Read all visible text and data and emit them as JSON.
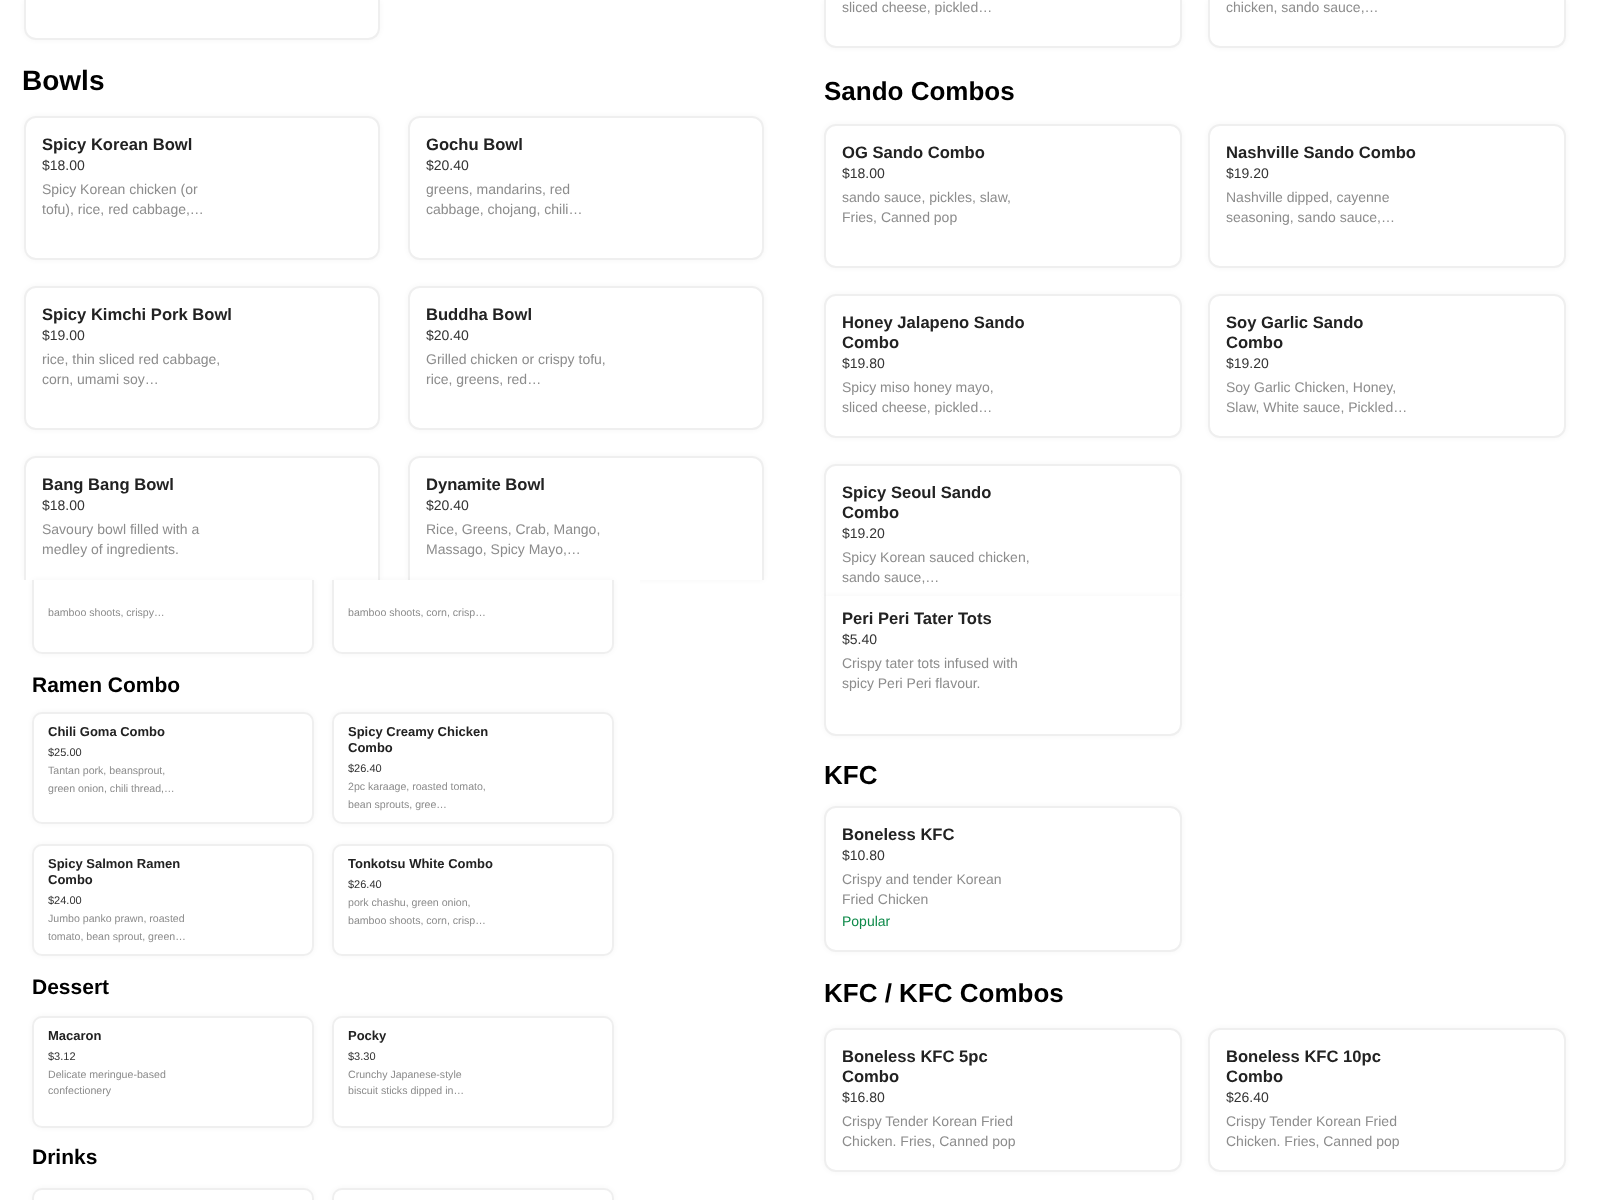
{
  "left_column": {
    "upper_view": {
      "sections": [
        {
          "heading": "Bowls",
          "items": [
            {
              "name": "Spicy Korean Bowl",
              "price": "$18.00",
              "description": "Spicy Korean chicken (or tofu), rice, red cabbage,…"
            },
            {
              "name": "Gochu Bowl",
              "price": "$20.40",
              "description": "greens, mandarins, red cabbage, chojang, chili…"
            },
            {
              "name": "Spicy Kimchi Pork Bowl",
              "price": "$19.00",
              "description": "rice, thin sliced red cabbage, corn, umami soy…"
            },
            {
              "name": "Buddha Bowl",
              "price": "$20.40",
              "description": "Grilled chicken or crispy tofu, rice, greens, red…"
            },
            {
              "name": "Bang Bang Bowl",
              "price": "$18.00",
              "description": "Savoury bowl filled with a medley of ingredients."
            },
            {
              "name": "Dynamite Bowl",
              "price": "$20.40",
              "description": "Rice, Greens, Crab, Mango, Massago, Spicy Mayo,…"
            }
          ]
        }
      ]
    },
    "lower_view": {
      "sections": [
        {
          "items": [
            {
              "description": "bamboo shoots, crispy…"
            },
            {
              "description": "bamboo shoots, corn, crisp…"
            }
          ]
        },
        {
          "heading": "Ramen Combo",
          "items": [
            {
              "name": "Chili Goma Combo",
              "price": "$25.00",
              "description": "Tantan pork, beansprout, green onion, chili thread,…"
            },
            {
              "name": "Spicy Creamy Chicken Combo",
              "price": "$26.40",
              "description": "2pc karaage, roasted tomato, bean sprouts, gree…"
            },
            {
              "name": "Spicy Salmon Ramen Combo",
              "price": "$24.00",
              "description": "Jumbo panko prawn, roasted tomato, bean sprout, green…"
            },
            {
              "name": "Tonkotsu White Combo",
              "price": "$26.40",
              "description": "pork chashu, green onion, bamboo shoots, corn, crisp…"
            }
          ]
        },
        {
          "heading": "Dessert",
          "items": [
            {
              "name": "Macaron",
              "price": "$3.12",
              "description": "Delicate meringue-based confectionery"
            },
            {
              "name": "Pocky",
              "price": "$3.30",
              "description": "Crunchy Japanese-style biscuit sticks dipped in…"
            }
          ]
        },
        {
          "heading": "Drinks"
        }
      ]
    }
  },
  "right_column": {
    "upper_view": {
      "sections": [
        {
          "items": [
            {
              "description": "sliced cheese, pickled…"
            },
            {
              "description": "chicken, sando sauce,…"
            }
          ]
        },
        {
          "heading": "Sando Combos",
          "items": [
            {
              "name": "OG Sando Combo",
              "price": "$18.00",
              "description": "sando sauce, pickles, slaw, Fries, Canned pop"
            },
            {
              "name": "Nashville Sando Combo",
              "price": "$19.20",
              "description": "Nashville dipped, cayenne seasoning, sando sauce,…"
            },
            {
              "name": "Honey Jalapeno Sando Combo",
              "price": "$19.80",
              "description": "Spicy miso honey mayo, sliced cheese, pickled…"
            },
            {
              "name": "Soy Garlic Sando Combo",
              "price": "$19.20",
              "description": "Soy Garlic Chicken, Honey, Slaw, White sauce, Pickled…"
            },
            {
              "name": "Spicy Seoul Sando Combo",
              "price": "$19.20",
              "description": "Spicy Korean sauced chicken, sando sauce,…"
            }
          ]
        }
      ]
    },
    "lower_view": {
      "sections": [
        {
          "items": [
            {
              "name": "Peri Peri Tater Tots",
              "price": "$5.40",
              "description": "Crispy tater tots infused with spicy Peri Peri flavour."
            }
          ]
        },
        {
          "heading": "KFC",
          "items": [
            {
              "name": "Boneless KFC",
              "price": "$10.80",
              "description": "Crispy and tender Korean Fried Chicken",
              "tag": "Popular"
            }
          ]
        },
        {
          "heading": "KFC / KFC Combos",
          "items": [
            {
              "name": "Boneless KFC 5pc Combo",
              "price": "$16.80",
              "description": "Crispy Tender Korean Fried Chicken. Fries, Canned pop"
            },
            {
              "name": "Boneless KFC 10pc Combo",
              "price": "$26.40",
              "description": "Crispy Tender Korean Fried Chicken. Fries, Canned pop"
            }
          ]
        }
      ]
    }
  }
}
